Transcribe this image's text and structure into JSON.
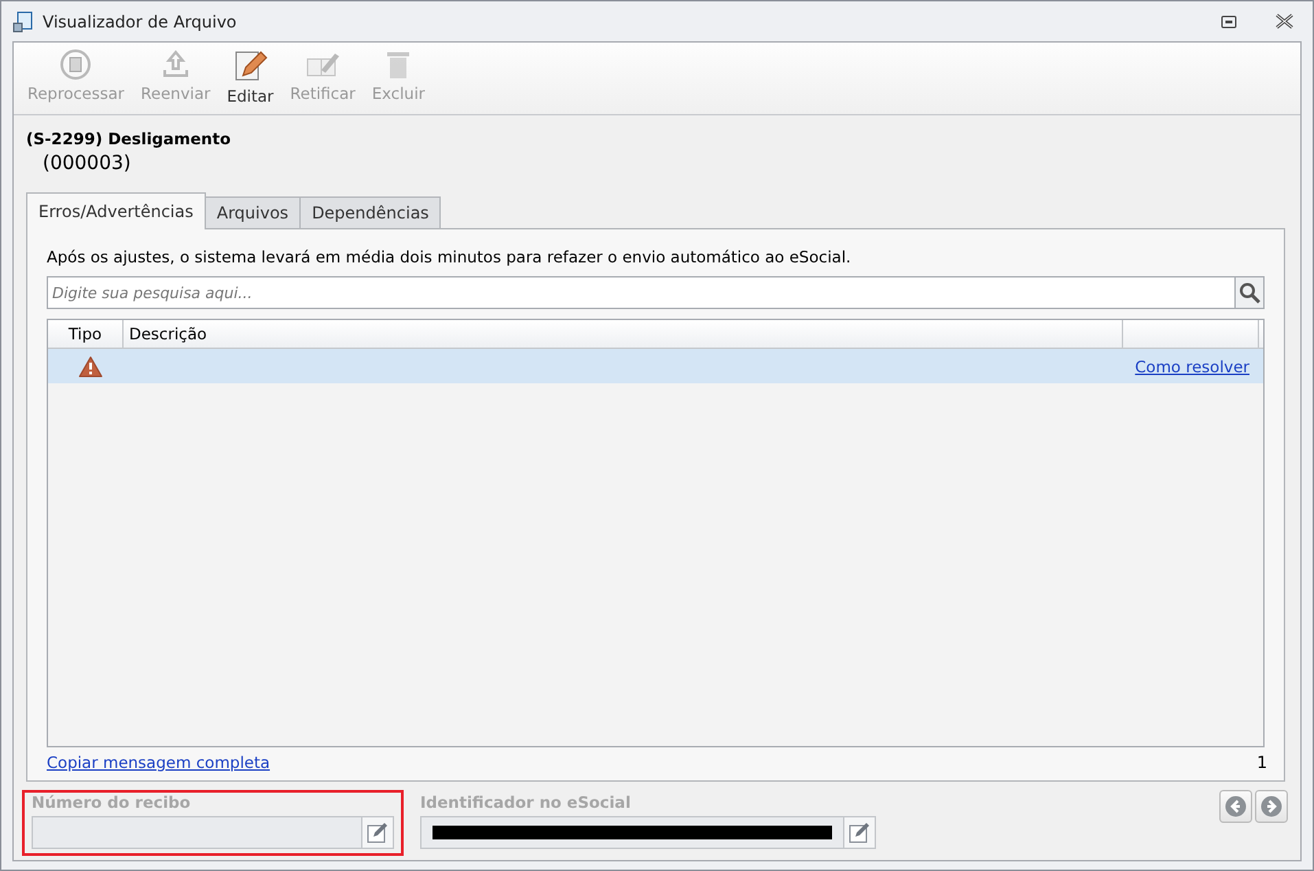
{
  "window": {
    "title": "Visualizador de Arquivo"
  },
  "toolbar": [
    {
      "kind": "reprocess",
      "label": "Reprocessar",
      "disabled": true
    },
    {
      "kind": "upload",
      "label": "Reenviar",
      "disabled": true
    },
    {
      "kind": "edit",
      "label": "Editar",
      "disabled": false
    },
    {
      "kind": "rectify",
      "label": "Retificar",
      "disabled": true
    },
    {
      "kind": "delete",
      "label": "Excluir",
      "disabled": true
    }
  ],
  "record": {
    "title": "(S-2299) Desligamento",
    "number": "(000003)"
  },
  "tabs": [
    {
      "label": "Erros/Advertências",
      "selected": true
    },
    {
      "label": "Arquivos",
      "selected": false
    },
    {
      "label": "Dependências",
      "selected": false
    }
  ],
  "notice": "Após os ajustes, o sistema levará em média dois minutos para refazer o envio automático ao eSocial.",
  "search": {
    "placeholder": "Digite sua pesquisa aqui..."
  },
  "table": {
    "columns": [
      "Tipo",
      "Descrição"
    ],
    "rows": [
      {
        "kind": "warning",
        "link": "Como resolver",
        "selected": true
      }
    ]
  },
  "copy_link": "Copiar mensagem completa",
  "count": "1",
  "fields": [
    {
      "label": "Número do recibo",
      "highlighted": true,
      "redacted": false
    },
    {
      "label": "Identificador no eSocial",
      "highlighted": false,
      "redacted": true
    }
  ]
}
